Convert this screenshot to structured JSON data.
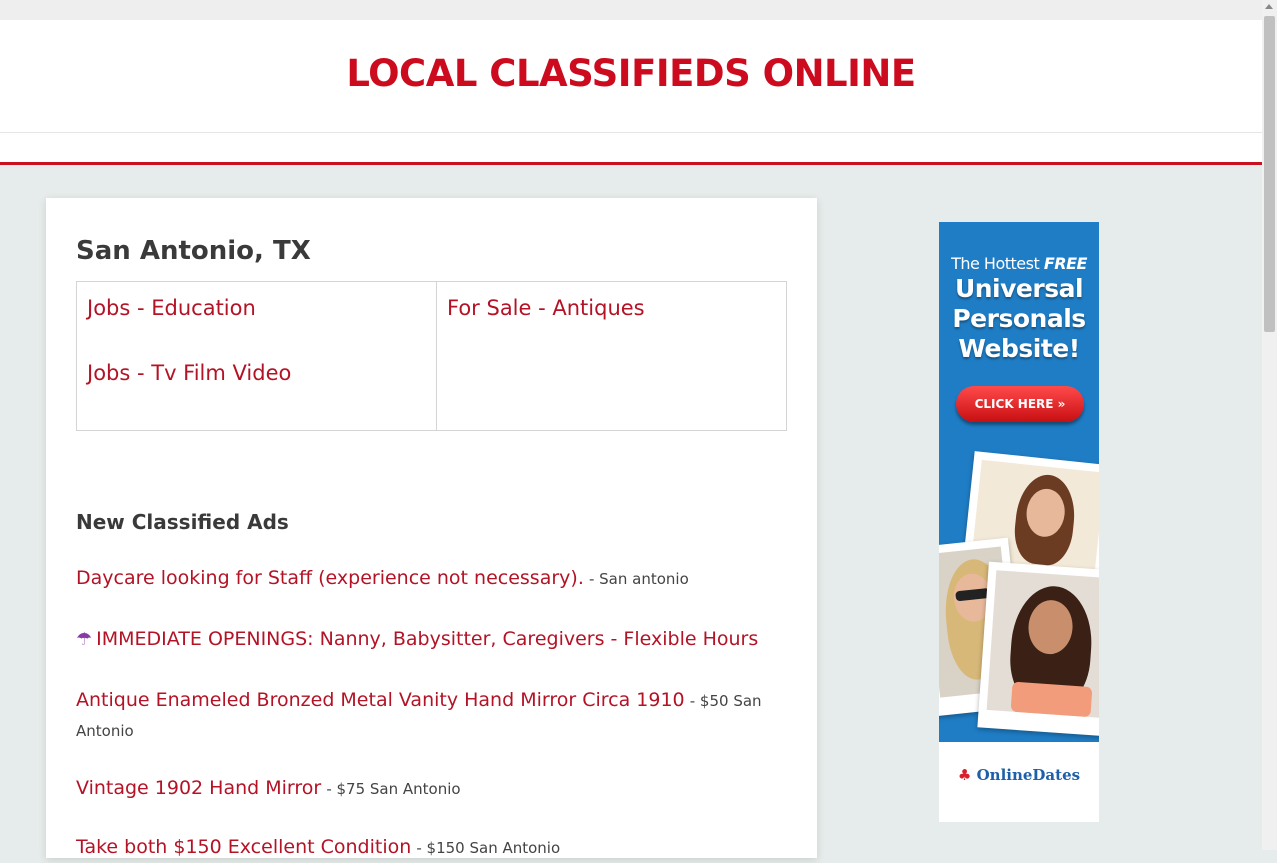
{
  "site": {
    "title": "LOCAL CLASSIFIEDS ONLINE"
  },
  "location": {
    "city": "San Antonio, TX"
  },
  "categories": {
    "left": [
      "Jobs - Education",
      "Jobs - Tv Film Video"
    ],
    "right": [
      "For Sale - Antiques"
    ]
  },
  "new_ads": {
    "heading": "New Classified Ads",
    "items": [
      {
        "title": "Daycare looking for Staff (experience not necessary).",
        "meta": "- San antonio"
      },
      {
        "icon": "umbrella-icon",
        "icon_glyph": "☂",
        "title": "IMMEDIATE OPENINGS: Nanny, Babysitter, Caregivers - Flexible Hours",
        "meta": ""
      },
      {
        "title": "Antique Enameled Bronzed Metal Vanity Hand Mirror Circa 1910",
        "meta": "- $50 San Antonio"
      },
      {
        "title": "Vintage 1902 Hand Mirror",
        "meta": "- $75 San Antonio"
      },
      {
        "title": "Take both $150 Excellent Condition",
        "meta": "- $150 San Antonio"
      }
    ]
  },
  "banner": {
    "line1": "The Hottest",
    "free": "FREE",
    "line2": "Universal",
    "line3": "Personals",
    "line4": "Website!",
    "button": "CLICK HERE »",
    "logo": "OnlineDates"
  },
  "colors": {
    "brand_red": "#cc0b1e",
    "link_red": "#b41326",
    "banner_blue": "#1f7dc5",
    "page_bg": "#e6eceb"
  }
}
